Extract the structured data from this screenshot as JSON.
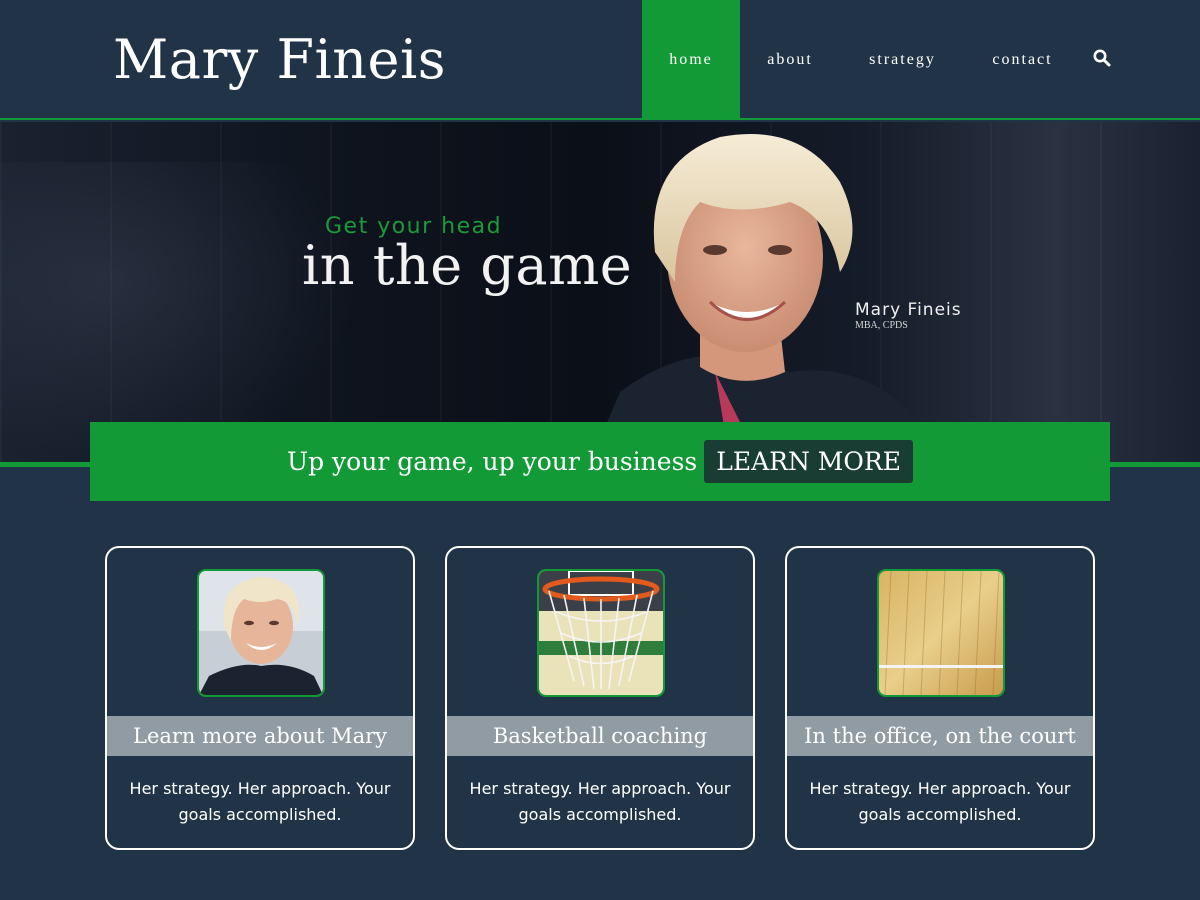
{
  "site": {
    "title": "Mary Fineis"
  },
  "nav": {
    "items": [
      {
        "label": "home",
        "active": true
      },
      {
        "label": "about",
        "active": false
      },
      {
        "label": "strategy",
        "active": false
      },
      {
        "label": "contact",
        "active": false
      }
    ],
    "search_icon": "search-icon"
  },
  "hero": {
    "tagline_small": "Get your head",
    "tagline_big": "in the game",
    "name": "Mary Fineis",
    "credentials": "MBA, CPDS"
  },
  "cta": {
    "text": "Up your game, up your business",
    "button_label": "LEARN MORE"
  },
  "cards": [
    {
      "title": "Learn more about Mary",
      "description": "Her strategy. Her approach. Your goals accomplished.",
      "image": "mary-portrait"
    },
    {
      "title": "Basketball coaching",
      "description": "Her strategy. Her approach. Your goals accomplished.",
      "image": "basketball-hoop"
    },
    {
      "title": "In the office, on the court",
      "description": "Her strategy. Her approach. Your goals accomplished.",
      "image": "hardwood-court"
    }
  ],
  "colors": {
    "background": "#213447",
    "accent_green": "#129a37",
    "button_dark": "#1a3d33",
    "card_title_bg": "#909ba3"
  }
}
